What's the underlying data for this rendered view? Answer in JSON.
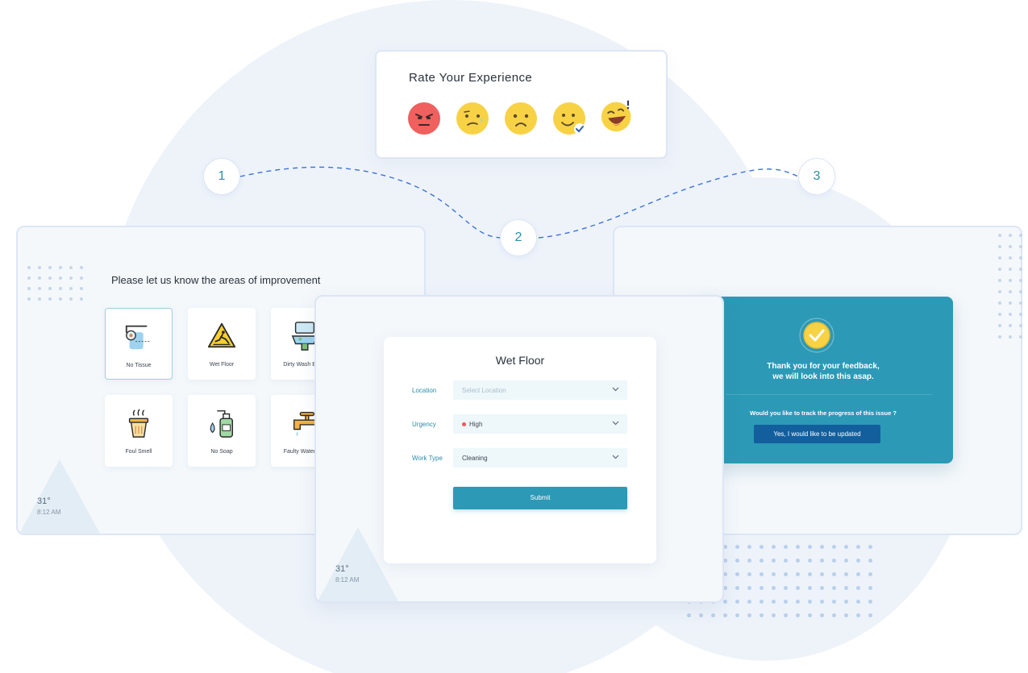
{
  "rating": {
    "title": "Rate Your Experience",
    "emojis": [
      "angry-face-icon",
      "worried-face-icon",
      "sad-face-icon",
      "smile-check-face-icon",
      "laughing-face-icon"
    ],
    "colors": {
      "angry": "#f0605e",
      "neutral": "#f8d245"
    }
  },
  "steps": [
    "1",
    "2",
    "3"
  ],
  "improvement": {
    "title": "Please let us know the areas of improvement",
    "tiles": [
      {
        "label": "No Tissue",
        "icon": "tissue-roll-icon"
      },
      {
        "label": "Wet Floor",
        "icon": "wet-floor-icon"
      },
      {
        "label": "Dirty Wash Basin",
        "icon": "wash-basin-icon"
      },
      {
        "label": "Foul Smell",
        "icon": "bin-smell-icon"
      },
      {
        "label": "No Soap",
        "icon": "soap-dispenser-icon"
      },
      {
        "label": "Faulty Water Tap",
        "icon": "water-tap-icon"
      }
    ],
    "clock": {
      "temp": "31°",
      "time": "8:12 AM"
    }
  },
  "form": {
    "title": "Wet Floor",
    "location_label": "Location",
    "location_placeholder": "Select Location",
    "urgency_label": "Urgency",
    "urgency_value": "High",
    "worktype_label": "Work Type",
    "worktype_value": "Cleaning",
    "submit_label": "Submit",
    "clock": {
      "temp": "31°",
      "time": "8:12 AM"
    }
  },
  "thanks": {
    "line1": "Thank you for your feedback,",
    "line2": "we will look into this asap.",
    "question": "Would you like to track the progress of this issue ?",
    "button_label": "Yes, I would like to be updated"
  },
  "colors": {
    "accent": "#2c99b6",
    "dark_button": "#135f9e",
    "urgency_high": "#f0565b"
  }
}
